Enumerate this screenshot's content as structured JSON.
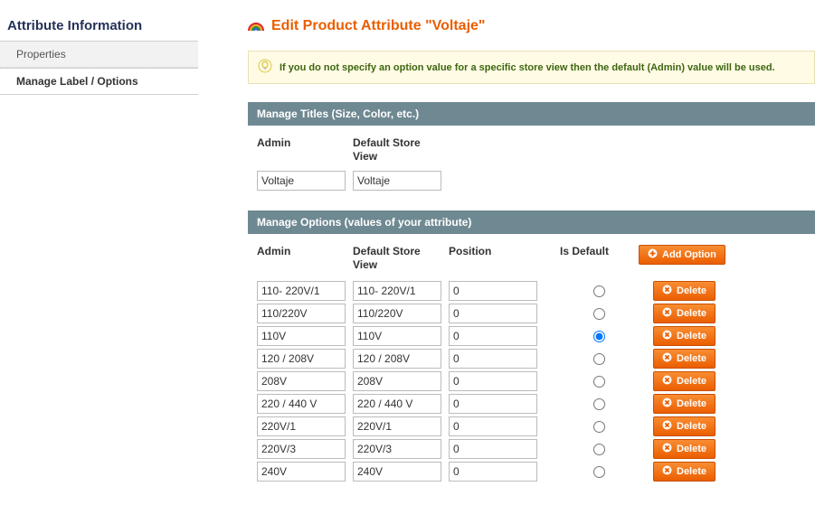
{
  "sidebar": {
    "title": "Attribute Information",
    "tabs": [
      {
        "label": "Properties",
        "active": false
      },
      {
        "label": "Manage Label / Options",
        "active": true
      }
    ]
  },
  "page": {
    "title": "Edit Product Attribute \"Voltaje\""
  },
  "message": {
    "text": "If you do not specify an option value for a specific store view then the default (Admin) value will be used."
  },
  "titles_section": {
    "header": "Manage Titles (Size, Color, etc.)",
    "columns": {
      "admin": "Admin",
      "store": "Default Store View"
    },
    "values": {
      "admin": "Voltaje",
      "store": "Voltaje"
    }
  },
  "options_section": {
    "header": "Manage Options (values of your attribute)",
    "columns": {
      "admin": "Admin",
      "store": "Default Store View",
      "position": "Position",
      "is_default": "Is Default"
    },
    "add_button": "Add Option",
    "delete_button": "Delete",
    "rows": [
      {
        "admin": "110- 220V/1",
        "store": "110- 220V/1",
        "position": "0",
        "is_default": false
      },
      {
        "admin": "110/220V",
        "store": "110/220V",
        "position": "0",
        "is_default": false
      },
      {
        "admin": "110V",
        "store": "110V",
        "position": "0",
        "is_default": true
      },
      {
        "admin": "120 / 208V",
        "store": "120 / 208V",
        "position": "0",
        "is_default": false
      },
      {
        "admin": "208V",
        "store": "208V",
        "position": "0",
        "is_default": false
      },
      {
        "admin": "220 / 440 V",
        "store": "220 / 440 V",
        "position": "0",
        "is_default": false
      },
      {
        "admin": "220V/1",
        "store": "220V/1",
        "position": "0",
        "is_default": false
      },
      {
        "admin": "220V/3",
        "store": "220V/3",
        "position": "0",
        "is_default": false
      },
      {
        "admin": "240V",
        "store": "240V",
        "position": "0",
        "is_default": false
      }
    ]
  }
}
